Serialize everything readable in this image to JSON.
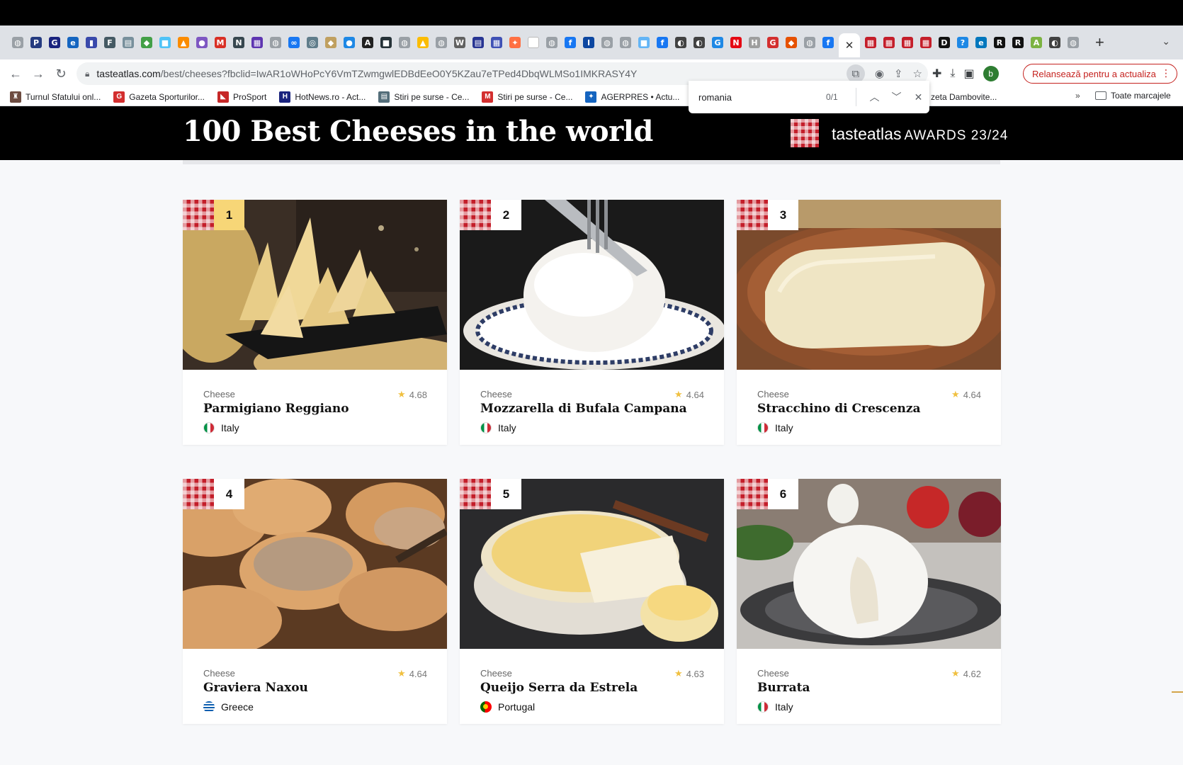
{
  "browser": {
    "tab_favicons": [
      {
        "icon": "globe-icon",
        "color": "#9aa0a6",
        "glyph": "◍"
      },
      {
        "icon": "paypal-icon",
        "color": "#253b80",
        "glyph": "P"
      },
      {
        "icon": "gl-icon",
        "color": "#1a237e",
        "glyph": "G"
      },
      {
        "icon": "ie-icon",
        "color": "#1565c0",
        "glyph": "e"
      },
      {
        "icon": "analytics-icon",
        "color": "#3949ab",
        "glyph": "▮"
      },
      {
        "icon": "fb-page-icon",
        "color": "#455a64",
        "glyph": "F"
      },
      {
        "icon": "doc-icon",
        "color": "#78909c",
        "glyph": "▤"
      },
      {
        "icon": "green-diamond-icon",
        "color": "#43a047",
        "glyph": "◆"
      },
      {
        "icon": "blue-square-icon",
        "color": "#4fc3f7",
        "glyph": "■"
      },
      {
        "icon": "chart-icon",
        "color": "#fb8c00",
        "glyph": "▲"
      },
      {
        "icon": "chat-icon",
        "color": "#7e57c2",
        "glyph": "●"
      },
      {
        "icon": "gmail-icon",
        "color": "#d93025",
        "glyph": "M"
      },
      {
        "icon": "news-icon",
        "color": "#37474f",
        "glyph": "N"
      },
      {
        "icon": "grid-icon",
        "color": "#5e35b1",
        "glyph": "▦"
      },
      {
        "icon": "globe-icon",
        "color": "#9aa0a6",
        "glyph": "◍"
      },
      {
        "icon": "meta-icon",
        "color": "#1877f2",
        "glyph": "∞"
      },
      {
        "icon": "world-icon",
        "color": "#607d8b",
        "glyph": "◎"
      },
      {
        "icon": "crest-icon",
        "color": "#c0a060",
        "glyph": "◆"
      },
      {
        "icon": "blue-circle-icon",
        "color": "#1e88e5",
        "glyph": "●"
      },
      {
        "icon": "letter-a-icon",
        "color": "#212121",
        "glyph": "A"
      },
      {
        "icon": "news-dark-icon",
        "color": "#263238",
        "glyph": "■"
      },
      {
        "icon": "globe-icon",
        "color": "#9aa0a6",
        "glyph": "◍"
      },
      {
        "icon": "drive-icon",
        "color": "#fbbc04",
        "glyph": "▲"
      },
      {
        "icon": "globe-icon",
        "color": "#9aa0a6",
        "glyph": "◍"
      },
      {
        "icon": "wikipedia-icon",
        "color": "#616161",
        "glyph": "W"
      },
      {
        "icon": "book-icon",
        "color": "#283593",
        "glyph": "▤"
      },
      {
        "icon": "calendar-icon",
        "color": "#3f51b5",
        "glyph": "▦"
      },
      {
        "icon": "puzzle-icon",
        "color": "#ff7043",
        "glyph": "✦"
      },
      {
        "icon": "blank-icon",
        "color": "#ffffff",
        "glyph": " "
      },
      {
        "icon": "globe-icon",
        "color": "#9aa0a6",
        "glyph": "◍"
      },
      {
        "icon": "facebook-icon",
        "color": "#1877f2",
        "glyph": "f"
      },
      {
        "icon": "ip-icon",
        "color": "#0d47a1",
        "glyph": "I"
      },
      {
        "icon": "globe-icon",
        "color": "#9aa0a6",
        "glyph": "◍"
      },
      {
        "icon": "globe-icon",
        "color": "#9aa0a6",
        "glyph": "◍"
      },
      {
        "icon": "blue-square-icon",
        "color": "#64b5f6",
        "glyph": "■"
      },
      {
        "icon": "facebook-icon",
        "color": "#1877f2",
        "glyph": "f"
      },
      {
        "icon": "pill-icon",
        "color": "#424242",
        "glyph": "◐"
      },
      {
        "icon": "pill-icon",
        "color": "#424242",
        "glyph": "◐"
      },
      {
        "icon": "g4-icon",
        "color": "#1e88e5",
        "glyph": "G"
      },
      {
        "icon": "netflix-icon",
        "color": "#e50914",
        "glyph": "N"
      },
      {
        "icon": "h-icon",
        "color": "#9e9e9e",
        "glyph": "H"
      }
    ],
    "tab_favicons_after": [
      {
        "icon": "g-red-icon",
        "color": "#d32f2f",
        "glyph": "G"
      },
      {
        "icon": "shield-icon",
        "color": "#e65100",
        "glyph": "◆"
      },
      {
        "icon": "globe-icon",
        "color": "#9aa0a6",
        "glyph": "◍"
      },
      {
        "icon": "facebook-icon",
        "color": "#1877f2",
        "glyph": "f"
      }
    ],
    "active_tab_close": "✕",
    "tab_favicons_right": [
      {
        "icon": "tasteatlas-icon",
        "color": "#c41e2a",
        "glyph": "▦"
      },
      {
        "icon": "tasteatlas-icon",
        "color": "#c41e2a",
        "glyph": "▦"
      },
      {
        "icon": "tasteatlas-icon",
        "color": "#c41e2a",
        "glyph": "▦"
      },
      {
        "icon": "tasteatlas-icon",
        "color": "#c41e2a",
        "glyph": "▦"
      },
      {
        "icon": "od-icon",
        "color": "#111111",
        "glyph": "D"
      },
      {
        "icon": "help-icon",
        "color": "#1e88e5",
        "glyph": "?"
      },
      {
        "icon": "ie-square-icon",
        "color": "#0277bd",
        "glyph": "e"
      },
      {
        "icon": "r-icon",
        "color": "#111111",
        "glyph": "R"
      },
      {
        "icon": "r-icon",
        "color": "#111111",
        "glyph": "R"
      },
      {
        "icon": "green-a-icon",
        "color": "#7cb342",
        "glyph": "A"
      },
      {
        "icon": "moon-icon",
        "color": "#424242",
        "glyph": "◐"
      },
      {
        "icon": "globe-icon",
        "color": "#9aa0a6",
        "glyph": "◍"
      }
    ],
    "new_tab": "+",
    "tab_list": "⌄",
    "url": "tasteatlas.com/best/cheeses?fbclid=IwAR1oWHoPcY6VmTZwmgwlEDBdEeO0Y5KZau7eTPed4DbqWLMSo1IMKRASY4Y",
    "url_domain": "tasteatlas.com",
    "url_path": "/best/cheeses?fbclid=IwAR1oWHoPcY6VmTZwmgwlEDBdEeO0Y5KZau7eTPed4DbqWLMSo1IMKRASY4Y",
    "relaunch_label": "Relansează pentru a actualiza",
    "avatar_letter": "b",
    "bookmarks": [
      {
        "label": "Turnul Sfatului onl...",
        "icon": "tower-icon",
        "color": "#6d4c41",
        "glyph": "♜"
      },
      {
        "label": "Gazeta Sporturilor...",
        "icon": "gsp-icon",
        "color": "#d32f2f",
        "glyph": "G"
      },
      {
        "label": "ProSport",
        "icon": "prosport-icon",
        "color": "#c62828",
        "glyph": "◣"
      },
      {
        "label": "HotNews.ro - Act...",
        "icon": "hotnews-icon",
        "color": "#1a237e",
        "glyph": "H"
      },
      {
        "label": "Stiri pe surse - Ce...",
        "icon": "stiri-icon",
        "color": "#546e7a",
        "glyph": "▤"
      },
      {
        "label": "Stiri pe surse - Ce...",
        "icon": "m-icon",
        "color": "#d32f2f",
        "glyph": "M"
      },
      {
        "label": "AGERPRES • Actu...",
        "icon": "agerpres-icon",
        "color": "#1565c0",
        "glyph": "✦"
      },
      {
        "label": "zeta Dambovite...",
        "icon": "",
        "color": "#ffffff",
        "glyph": ""
      }
    ],
    "bookmarks_more": "»",
    "bookmarks_folder": "Toate marcajele",
    "find": {
      "query": "romania",
      "count": "0/1"
    }
  },
  "site": {
    "title": "100 Best Cheeses in the world",
    "award_brand": "tasteatlas",
    "award_text": "AWARDS 23/24",
    "colors": {
      "brand_red": "#c41e2a",
      "rank1_gold": "#f7d677",
      "star": "#f0c040"
    }
  },
  "cards": [
    {
      "rank": "1",
      "category": "Cheese",
      "rating": "4.68",
      "name": "Parmigiano Reggiano",
      "country": "Italy",
      "flag": "it",
      "image": "parmigiano"
    },
    {
      "rank": "2",
      "category": "Cheese",
      "rating": "4.64",
      "name": "Mozzarella di Bufala Campana",
      "country": "Italy",
      "flag": "it",
      "image": "mozzarella"
    },
    {
      "rank": "3",
      "category": "Cheese",
      "rating": "4.64",
      "name": "Stracchino di Crescenza",
      "country": "Italy",
      "flag": "it",
      "image": "stracchino"
    },
    {
      "rank": "4",
      "category": "Cheese",
      "rating": "4.64",
      "name": "Graviera Naxou",
      "country": "Greece",
      "flag": "gr",
      "image": "graviera"
    },
    {
      "rank": "5",
      "category": "Cheese",
      "rating": "4.63",
      "name": "Queijo Serra da Estrela",
      "country": "Portugal",
      "flag": "pt",
      "image": "queijo"
    },
    {
      "rank": "6",
      "category": "Cheese",
      "rating": "4.62",
      "name": "Burrata",
      "country": "Italy",
      "flag": "it",
      "image": "burrata"
    }
  ]
}
